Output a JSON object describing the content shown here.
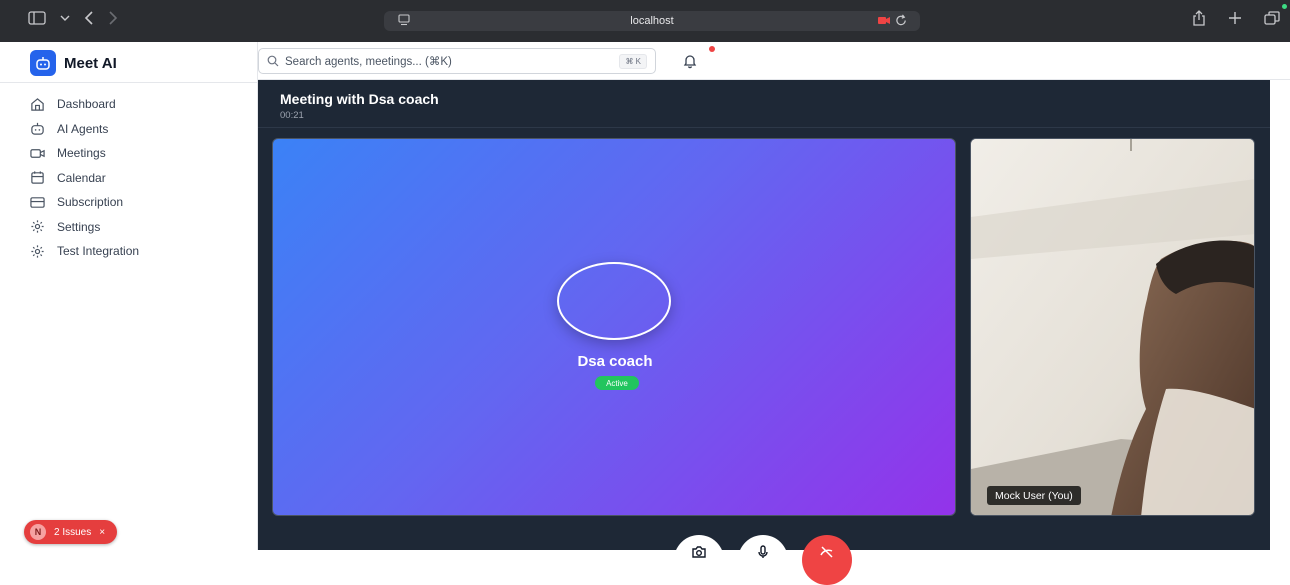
{
  "browser": {
    "url": "localhost"
  },
  "brand": {
    "name": "Meet AI"
  },
  "sidebar": {
    "items": [
      {
        "label": "Dashboard",
        "icon": "home-icon"
      },
      {
        "label": "AI Agents",
        "icon": "bot-icon"
      },
      {
        "label": "Meetings",
        "icon": "video-icon"
      },
      {
        "label": "Calendar",
        "icon": "calendar-icon"
      },
      {
        "label": "Subscription",
        "icon": "card-icon"
      },
      {
        "label": "Settings",
        "icon": "gear-icon"
      },
      {
        "label": "Test Integration",
        "icon": "gear-icon"
      }
    ]
  },
  "search": {
    "placeholder": "Search agents, meetings... (⌘K)",
    "shortcut": "⌘ K"
  },
  "meeting": {
    "title": "Meeting with Dsa coach",
    "timer": "00:21",
    "agent_name": "Dsa coach",
    "agent_status": "Active",
    "user_label": "Mock User (You)"
  },
  "dev_overlay": {
    "badge": "N",
    "issues_label": "2 Issues",
    "close": "×"
  },
  "colors": {
    "brand": "#2563eb",
    "active": "#22c55e",
    "end_call": "#ef4444",
    "gradient_start": "#3b82f6",
    "gradient_end": "#9333ea"
  }
}
